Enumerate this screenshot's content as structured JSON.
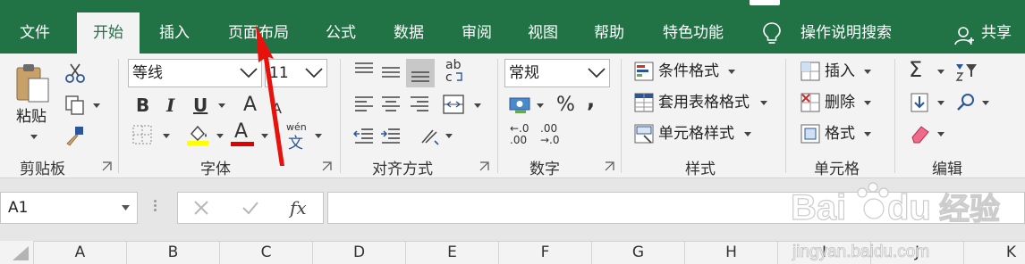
{
  "tabs": [
    {
      "label": "文件",
      "active": false
    },
    {
      "label": "开始",
      "active": true
    },
    {
      "label": "插入",
      "active": false
    },
    {
      "label": "页面布局",
      "active": false
    },
    {
      "label": "公式",
      "active": false
    },
    {
      "label": "数据",
      "active": false
    },
    {
      "label": "审阅",
      "active": false
    },
    {
      "label": "视图",
      "active": false
    },
    {
      "label": "帮助",
      "active": false
    },
    {
      "label": "特色功能",
      "active": false
    }
  ],
  "tell_me": "操作说明搜索",
  "share": "共享",
  "clipboard": {
    "paste": "粘贴",
    "group": "剪贴板"
  },
  "font": {
    "name": "等线",
    "size": "11",
    "bold": "B",
    "italic": "I",
    "underline": "U",
    "grow": "A",
    "shrink": "A",
    "color_letter": "A",
    "phonetic_top": "wén",
    "phonetic_bottom": "文",
    "group": "字体"
  },
  "alignment": {
    "group": "对齐方式",
    "wrap_top": "ab",
    "wrap_bottom": "c"
  },
  "number": {
    "format": "常规",
    "percent": "%",
    "comma": ",",
    "inc_top": "←.0",
    "inc_bottom": ".00",
    "dec_top": ".00",
    "dec_bottom": "→.0",
    "group": "数字"
  },
  "styles": {
    "conditional": "条件格式",
    "table": "套用表格格式",
    "cell": "单元格样式",
    "group": "样式"
  },
  "cells": {
    "insert": "插入",
    "delete": "删除",
    "format": "格式",
    "group": "单元格"
  },
  "editing": {
    "sum": "Σ",
    "group": "编辑"
  },
  "name_box": "A1",
  "fx": "fx",
  "columns": [
    "A",
    "B",
    "C",
    "D",
    "E",
    "F",
    "G",
    "H",
    "I",
    "J",
    "K"
  ],
  "watermark": {
    "brand": "Bai",
    "brand_tail": "du",
    "cn": "经验",
    "url": "jingyan.baidu.com"
  },
  "colors": {
    "excel_green": "#217346",
    "arrow_red": "#e8120c",
    "font_red": "#e00000",
    "highlight_yellow": "#ffff00"
  }
}
